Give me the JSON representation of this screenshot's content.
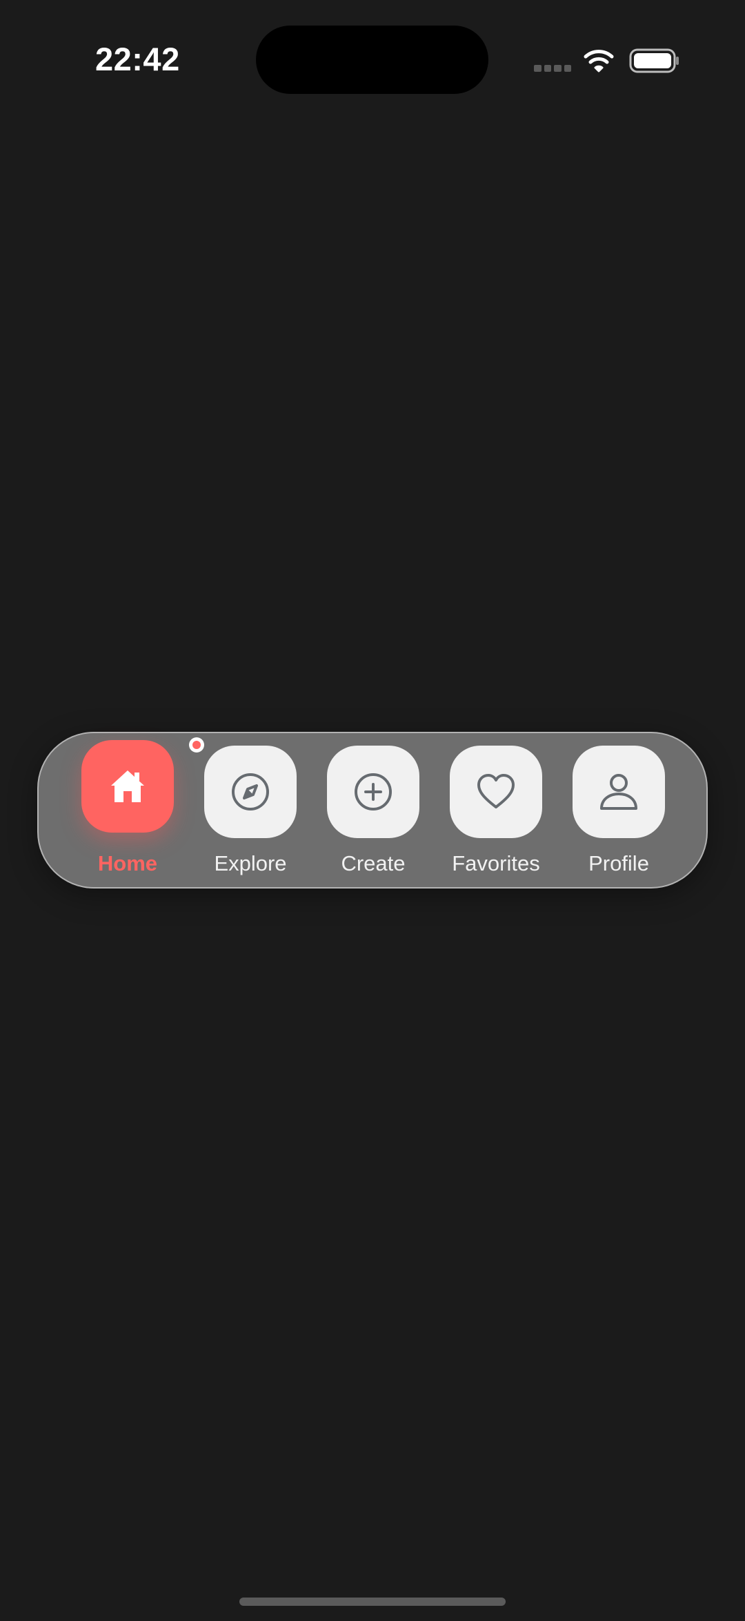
{
  "status_bar": {
    "time": "22:42",
    "signal_icon": "signal-bars-icon",
    "wifi_icon": "wifi-icon",
    "battery_icon": "battery-icon"
  },
  "tab_bar": {
    "active_color": "#ff6461",
    "tabs": [
      {
        "label": "Home",
        "icon": "home-icon",
        "active": true,
        "badge": true
      },
      {
        "label": "Explore",
        "icon": "compass-icon",
        "active": false
      },
      {
        "label": "Create",
        "icon": "plus-circle-icon",
        "active": false
      },
      {
        "label": "Favorites",
        "icon": "heart-icon",
        "active": false
      },
      {
        "label": "Profile",
        "icon": "person-icon",
        "active": false
      }
    ]
  }
}
